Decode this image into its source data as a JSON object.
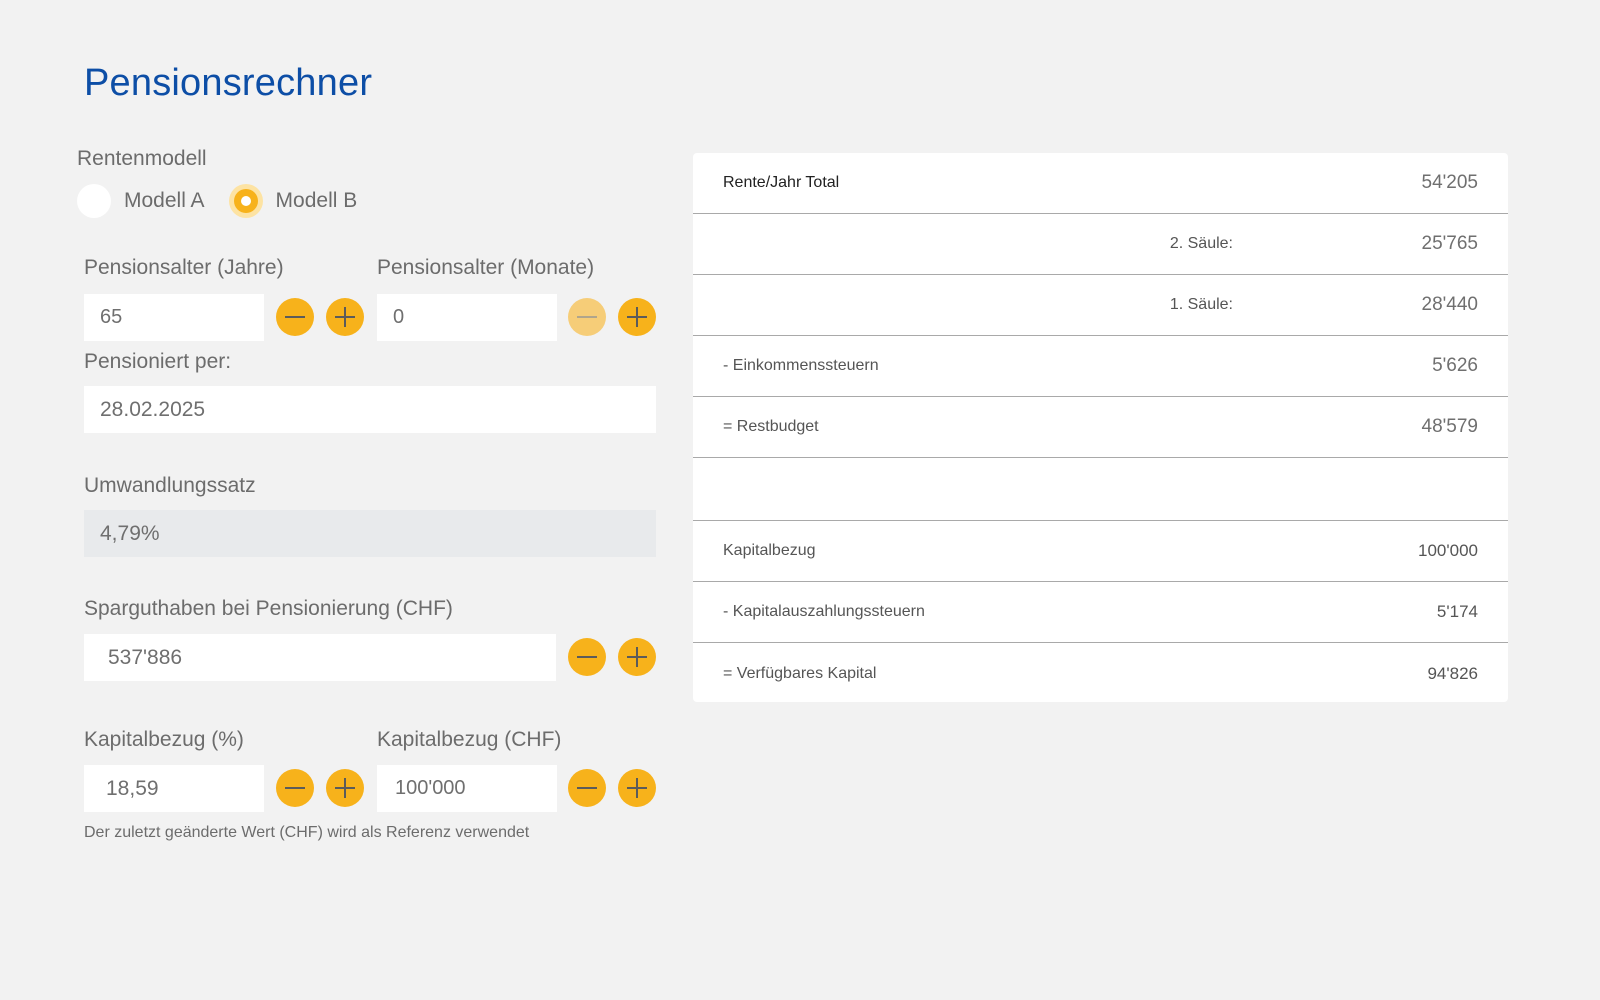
{
  "page": {
    "title": "Pensionsrechner"
  },
  "rentenmodell": {
    "label": "Rentenmodell",
    "options": [
      {
        "label": "Modell A",
        "selected": false
      },
      {
        "label": "Modell B",
        "selected": true
      }
    ]
  },
  "pensionsalter_jahre": {
    "label": "Pensionsalter (Jahre)",
    "value": "65"
  },
  "pensionsalter_monate": {
    "label": "Pensionsalter (Monate)",
    "value": "0"
  },
  "pensioniert_per": {
    "label": "Pensioniert per:",
    "value": "28.02.2025"
  },
  "umwandlungssatz": {
    "label": "Umwandlungssatz",
    "value": "4,79%"
  },
  "sparguthaben": {
    "label": "Sparguthaben bei Pensionierung (CHF)",
    "value": "537'886"
  },
  "kapitalbezug_pct": {
    "label": "Kapitalbezug (%)",
    "value": "18,59"
  },
  "kapitalbezug_chf": {
    "label": "Kapitalbezug (CHF)",
    "value": "100'000"
  },
  "hint": "Der zuletzt geänderte Wert (CHF) wird als Referenz verwendet",
  "results": {
    "rows": [
      {
        "label": "Rente/Jahr Total",
        "sub": "",
        "value": "54'205"
      },
      {
        "label": "",
        "sub": "2. Säule:",
        "value": "25'765"
      },
      {
        "label": "",
        "sub": "1. Säule:",
        "value": "28'440"
      },
      {
        "label": "- Einkommenssteuern",
        "sub": "",
        "value": "5'626"
      },
      {
        "label": "= Restbudget",
        "sub": "",
        "value": "48'579"
      },
      {
        "label": "",
        "sub": "",
        "value": ""
      },
      {
        "label": "Kapitalbezug",
        "sub": "",
        "value": "100'000"
      },
      {
        "label": "- Kapitalauszahlungssteuern",
        "sub": "",
        "value": "5'174"
      },
      {
        "label": "= Verfügbares Kapital",
        "sub": "",
        "value": "94'826"
      }
    ]
  },
  "colors": {
    "accent": "#f7b21b",
    "title": "#0d4ea6",
    "background": "#f2f2f2"
  },
  "icons": {
    "minus": "minus-icon",
    "plus": "plus-icon"
  }
}
